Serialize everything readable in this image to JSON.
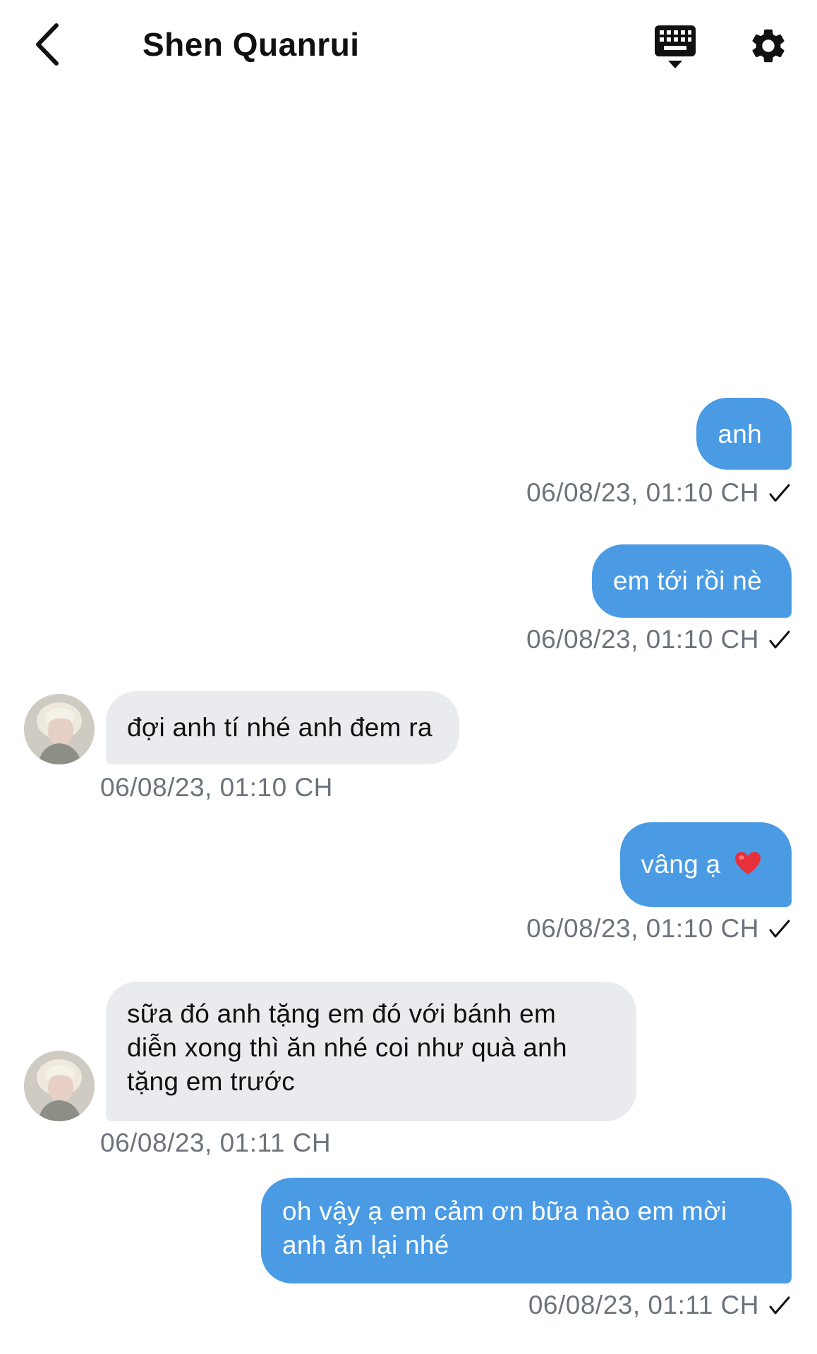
{
  "header": {
    "back_icon": "chevron-left-icon",
    "title": "Shen Quanrui",
    "keyboard_icon": "keyboard-icon",
    "settings_icon": "gear-icon"
  },
  "colors": {
    "outgoing_bubble": "#4a9be4",
    "incoming_bubble": "#e9ebee",
    "timestamp": "#6c737c"
  },
  "messages": [
    {
      "direction": "outgoing",
      "text": "anh",
      "timestamp": "06/08/23, 01:10 CH",
      "status_icon": "checkmark-icon"
    },
    {
      "direction": "outgoing",
      "text": "em tới rồi nè",
      "timestamp": "06/08/23, 01:10 CH",
      "status_icon": "checkmark-icon"
    },
    {
      "direction": "incoming",
      "text": "đợi anh tí nhé anh đem ra",
      "timestamp": "06/08/23, 01:10 CH",
      "avatar": "avatar"
    },
    {
      "direction": "outgoing",
      "text": "vâng ạ",
      "emoji": "heart-icon",
      "timestamp": "06/08/23, 01:10 CH",
      "status_icon": "checkmark-icon"
    },
    {
      "direction": "incoming",
      "text": "sữa đó anh tặng em đó với bánh em diễn xong thì ăn nhé coi như quà anh tặng em trước",
      "timestamp": "06/08/23, 01:11 CH",
      "avatar": "avatar"
    },
    {
      "direction": "outgoing",
      "text": "oh vậy ạ em cảm ơn bữa nào em mời anh ăn lại nhé",
      "timestamp": "06/08/23, 01:11 CH",
      "status_icon": "checkmark-icon"
    }
  ]
}
